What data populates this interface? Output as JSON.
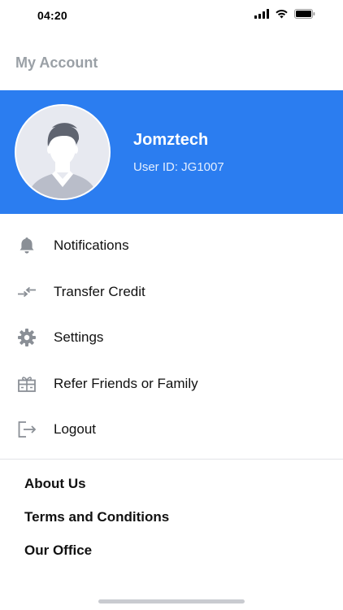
{
  "status_bar": {
    "time": "04:20"
  },
  "header": {
    "title": "My Account"
  },
  "profile": {
    "name": "Jomztech",
    "user_id": "User ID: JG1007"
  },
  "menu": {
    "items": [
      {
        "label": "Notifications",
        "icon": "bell-icon"
      },
      {
        "label": "Transfer Credit",
        "icon": "transfer-arrows-icon"
      },
      {
        "label": "Settings",
        "icon": "gear-icon"
      },
      {
        "label": "Refer Friends or Family",
        "icon": "gift-icon"
      },
      {
        "label": "Logout",
        "icon": "logout-icon"
      }
    ]
  },
  "footer": {
    "links": [
      {
        "label": "About Us"
      },
      {
        "label": "Terms and Conditions"
      },
      {
        "label": "Our Office"
      }
    ]
  },
  "colors": {
    "accent": "#2b7df0",
    "title_gray": "#9aa0a6",
    "icon_gray": "#8a8f96"
  }
}
